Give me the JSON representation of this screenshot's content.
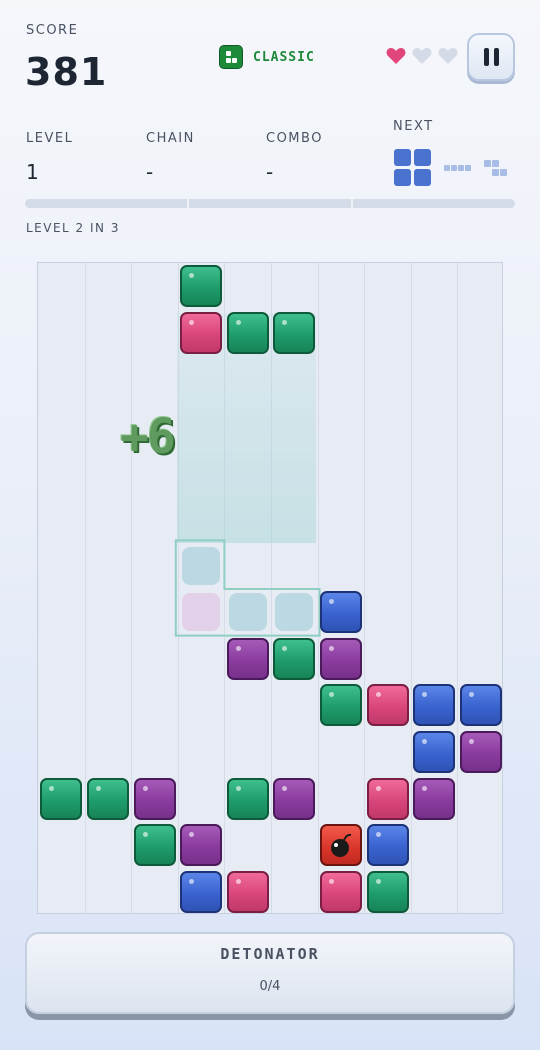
{
  "header": {
    "score_label": "SCORE",
    "score_value": "381",
    "mode_label": "CLASSIC",
    "mode_icon": "classic-mode-icon",
    "lives": {
      "total": 3,
      "remaining": 1,
      "icon": "heart-icon",
      "color_full": "#e0457b",
      "color_empty": "#d4dae6"
    },
    "pause_icon": "pause-icon"
  },
  "stats": {
    "level_label": "LEVEL",
    "level_value": "1",
    "chain_label": "CHAIN",
    "chain_value": "-",
    "combo_label": "COMBO",
    "combo_value": "-",
    "next_label": "NEXT",
    "next_pieces": [
      "square-piece",
      "line-piece",
      "s-piece"
    ]
  },
  "progress": {
    "text": "LEVEL 2 IN 3",
    "fraction": 0
  },
  "board": {
    "cols": 10,
    "rows": 14,
    "combo_popup": "+6",
    "falling_piece": [
      {
        "col": 3,
        "row": 0,
        "color": "green"
      },
      {
        "col": 3,
        "row": 1,
        "color": "pink"
      },
      {
        "col": 4,
        "row": 1,
        "color": "green"
      },
      {
        "col": 5,
        "row": 1,
        "color": "green"
      }
    ],
    "ghost_piece": [
      {
        "col": 3,
        "row": 6,
        "color": "teal"
      },
      {
        "col": 3,
        "row": 7,
        "color": "pink"
      },
      {
        "col": 4,
        "row": 7,
        "color": "teal"
      },
      {
        "col": 5,
        "row": 7,
        "color": "teal"
      }
    ],
    "settled_blocks": [
      {
        "col": 6,
        "row": 7,
        "color": "blue"
      },
      {
        "col": 4,
        "row": 8,
        "color": "purple"
      },
      {
        "col": 5,
        "row": 8,
        "color": "green"
      },
      {
        "col": 6,
        "row": 8,
        "color": "purple"
      },
      {
        "col": 6,
        "row": 9,
        "color": "green"
      },
      {
        "col": 7,
        "row": 9,
        "color": "pink"
      },
      {
        "col": 8,
        "row": 9,
        "color": "blue"
      },
      {
        "col": 9,
        "row": 9,
        "color": "blue"
      },
      {
        "col": 8,
        "row": 10,
        "color": "blue"
      },
      {
        "col": 9,
        "row": 10,
        "color": "purple"
      },
      {
        "col": 0,
        "row": 11,
        "color": "green"
      },
      {
        "col": 1,
        "row": 11,
        "color": "green"
      },
      {
        "col": 2,
        "row": 11,
        "color": "purple"
      },
      {
        "col": 4,
        "row": 11,
        "color": "green"
      },
      {
        "col": 5,
        "row": 11,
        "color": "purple"
      },
      {
        "col": 7,
        "row": 11,
        "color": "pink"
      },
      {
        "col": 8,
        "row": 11,
        "color": "purple"
      },
      {
        "col": 2,
        "row": 12,
        "color": "green"
      },
      {
        "col": 3,
        "row": 12,
        "color": "purple"
      },
      {
        "col": 6,
        "row": 12,
        "color": "bomb"
      },
      {
        "col": 7,
        "row": 12,
        "color": "blue"
      },
      {
        "col": 3,
        "row": 13,
        "color": "blue"
      },
      {
        "col": 4,
        "row": 13,
        "color": "pink"
      },
      {
        "col": 6,
        "row": 13,
        "color": "pink"
      },
      {
        "col": 7,
        "row": 13,
        "color": "green"
      }
    ],
    "bomb_icon": "bomb-icon"
  },
  "detonator": {
    "label": "DETONATOR",
    "count": "0/4"
  }
}
